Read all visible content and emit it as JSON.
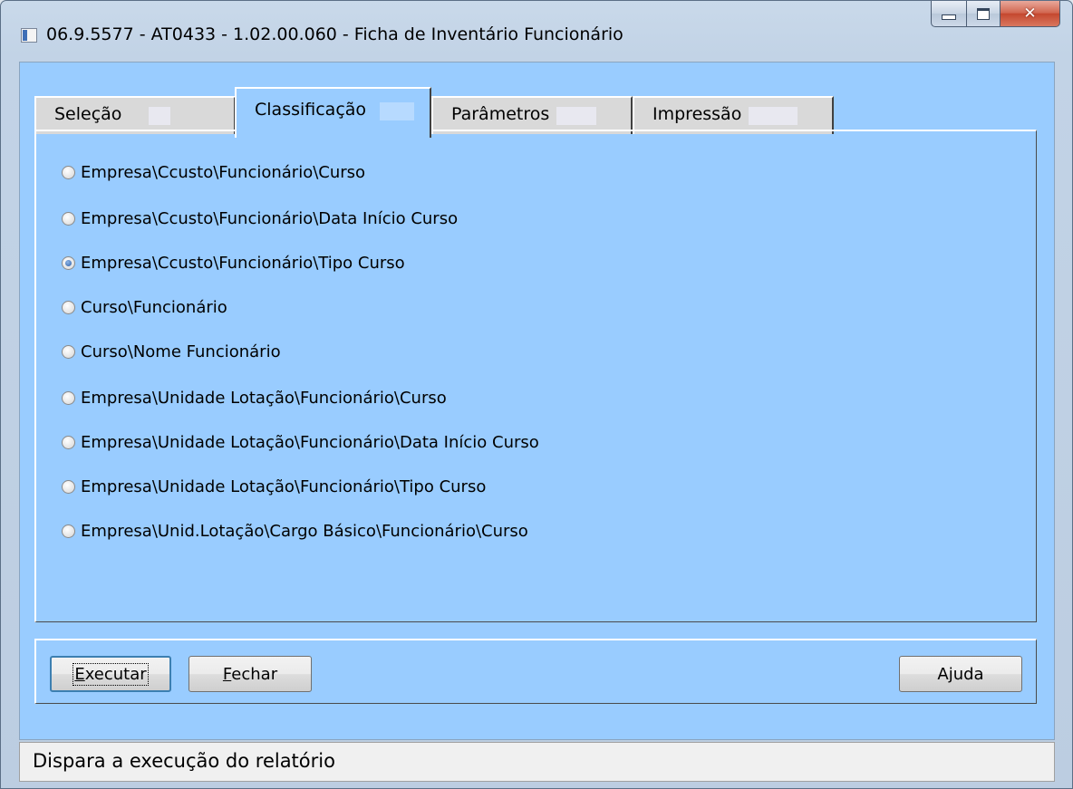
{
  "window": {
    "title": "06.9.5577 - AT0433 - 1.02.00.060 - Ficha de Inventário Funcionário"
  },
  "tabs": [
    {
      "label": "Seleção",
      "active": false
    },
    {
      "label": "Classificação",
      "active": true
    },
    {
      "label": "Parâmetros",
      "active": false
    },
    {
      "label": "Impressão",
      "active": false
    }
  ],
  "classification": {
    "options": [
      {
        "label": "Empresa\\Ccusto\\Funcionário\\Curso",
        "checked": false
      },
      {
        "label": "Empresa\\Ccusto\\Funcionário\\Data Início Curso",
        "checked": false
      },
      {
        "label": "Empresa\\Ccusto\\Funcionário\\Tipo Curso",
        "checked": true
      },
      {
        "label": "Curso\\Funcionário",
        "checked": false
      },
      {
        "label": "Curso\\Nome Funcionário",
        "checked": false
      },
      {
        "label": "Empresa\\Unidade Lotação\\Funcionário\\Curso",
        "checked": false
      },
      {
        "label": "Empresa\\Unidade Lotação\\Funcionário\\Data Início Curso",
        "checked": false
      },
      {
        "label": "Empresa\\Unidade Lotação\\Funcionário\\Tipo Curso",
        "checked": false
      },
      {
        "label": "Empresa\\Unid.Lotação\\Cargo Básico\\Funcionário\\Curso",
        "checked": false
      }
    ]
  },
  "buttons": {
    "execute": {
      "mnemonic": "E",
      "rest": "xecutar"
    },
    "close": {
      "mnemonic": "F",
      "rest": "echar"
    },
    "help": "Ajuda"
  },
  "statusbar": {
    "text": "Dispara a execução do relatório"
  },
  "colors": {
    "client_background": "#99ccff",
    "tab_inactive": "#d9d9d9",
    "statusbar_background": "#f0f0f0"
  },
  "icons": [
    "app-icon",
    "minimize-icon",
    "maximize-icon",
    "close-icon"
  ]
}
